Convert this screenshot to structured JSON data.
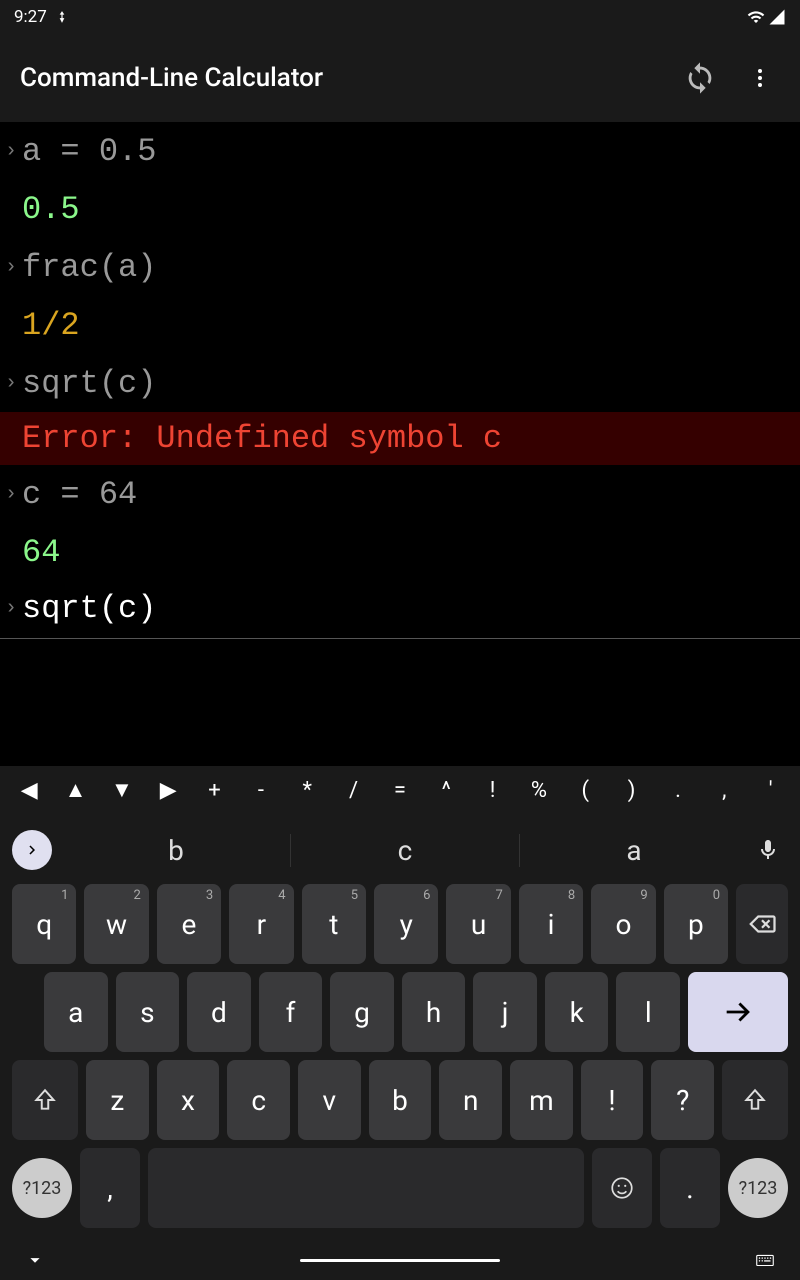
{
  "statusBar": {
    "time": "9:27"
  },
  "appBar": {
    "title": "Command-Line Calculator"
  },
  "terminal": {
    "lines": [
      {
        "type": "input",
        "text": "a = 0.5"
      },
      {
        "type": "result",
        "text": "0.5",
        "style": "green"
      },
      {
        "type": "input",
        "text": "frac(a)"
      },
      {
        "type": "result",
        "text": "1/2",
        "style": "yellow"
      },
      {
        "type": "input",
        "text": "sqrt(c)"
      },
      {
        "type": "error",
        "text": "Error: Undefined symbol c"
      },
      {
        "type": "input",
        "text": "c = 64"
      },
      {
        "type": "result",
        "text": "64",
        "style": "green"
      },
      {
        "type": "current",
        "text": "sqrt(c)"
      }
    ]
  },
  "symbolRow": [
    "◀",
    "▲",
    "▼",
    "▶",
    "+",
    "-",
    "*",
    "/",
    "=",
    "^",
    "!",
    "%",
    "(",
    ")",
    ".",
    ",",
    "'"
  ],
  "suggestions": [
    "b",
    "c",
    "a"
  ],
  "keyboard": {
    "row1": [
      {
        "k": "q",
        "n": "1"
      },
      {
        "k": "w",
        "n": "2"
      },
      {
        "k": "e",
        "n": "3"
      },
      {
        "k": "r",
        "n": "4"
      },
      {
        "k": "t",
        "n": "5"
      },
      {
        "k": "y",
        "n": "6"
      },
      {
        "k": "u",
        "n": "7"
      },
      {
        "k": "i",
        "n": "8"
      },
      {
        "k": "o",
        "n": "9"
      },
      {
        "k": "p",
        "n": "0"
      }
    ],
    "row2": [
      "a",
      "s",
      "d",
      "f",
      "g",
      "h",
      "j",
      "k",
      "l"
    ],
    "row3": [
      "z",
      "x",
      "c",
      "v",
      "b",
      "n",
      "m",
      "!",
      "?"
    ],
    "modeKey": "?123"
  }
}
